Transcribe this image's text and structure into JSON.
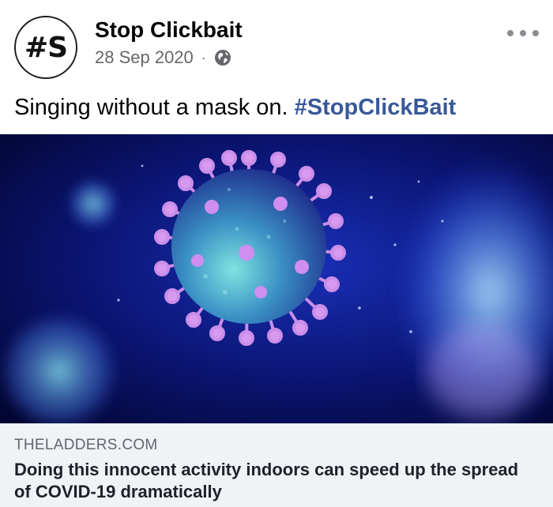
{
  "post": {
    "page_name": "Stop Clickbait",
    "avatar_text": "#S",
    "date": "28 Sep 2020",
    "separator": "·",
    "privacy_icon": "globe-icon",
    "more_icon": "more-options-icon",
    "caption_text": "Singing without a mask on. ",
    "caption_hashtag": "#StopClickBait"
  },
  "link_preview": {
    "domain": "THELADDERS.COM",
    "headline": "Doing this innocent activity indoors can speed up the spread of COVID-19 dramatically"
  },
  "colors": {
    "hashtag": "#385898",
    "meta_text": "#65676b",
    "link_box_bg": "#f0f2f5"
  }
}
